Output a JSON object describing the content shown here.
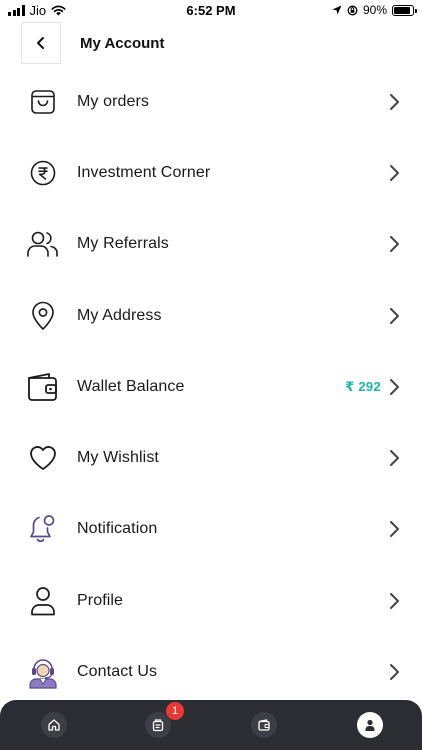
{
  "status_bar": {
    "carrier": "Jio",
    "time": "6:52 PM",
    "battery": "90%",
    "battery_level": 0.9
  },
  "header": {
    "title": "My Account",
    "back_icon": "chevron-left-icon"
  },
  "menu": {
    "items": [
      {
        "label": "My orders",
        "icon": "shopping-bag-icon"
      },
      {
        "label": "Investment Corner",
        "icon": "rupee-coin-icon"
      },
      {
        "label": "My Referrals",
        "icon": "users-icon"
      },
      {
        "label": "My Address",
        "icon": "location-pin-icon"
      },
      {
        "label": "Wallet Balance",
        "icon": "wallet-icon",
        "value": "₹ 292"
      },
      {
        "label": "My Wishlist",
        "icon": "heart-icon"
      },
      {
        "label": "Notification",
        "icon": "bell-icon"
      },
      {
        "label": "Profile",
        "icon": "person-icon"
      },
      {
        "label": "Contact Us",
        "icon": "support-agent-icon"
      }
    ],
    "value_color": "#1bb5a6"
  },
  "bottom_nav": {
    "background": "#2b2d33",
    "items": [
      {
        "label": "",
        "icon": "home-icon"
      },
      {
        "label": "",
        "icon": "orders-icon",
        "badge": "1"
      },
      {
        "label": "",
        "icon": "wallet-icon"
      },
      {
        "label": "",
        "icon": "account-icon",
        "active": true
      }
    ],
    "badge_color": "#e53935"
  }
}
